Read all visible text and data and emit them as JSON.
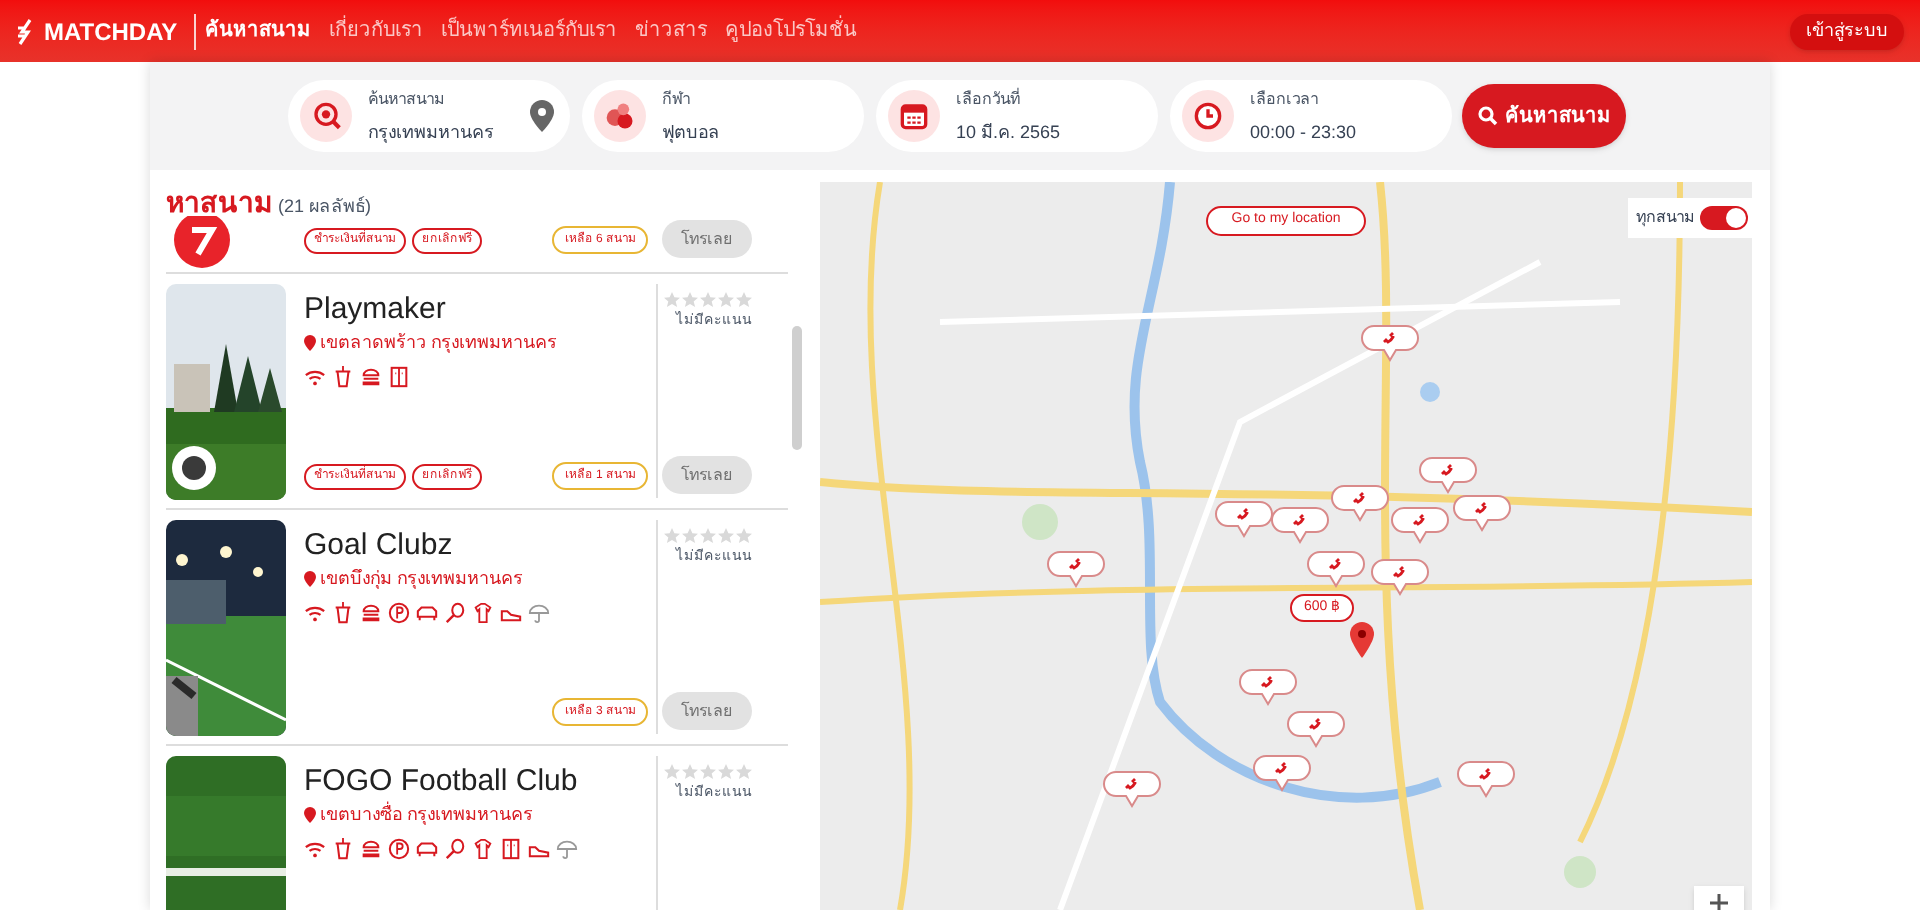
{
  "header": {
    "brand": "MATCHDAY",
    "nav": [
      {
        "label": "ค้นหาสนาม",
        "selected": true
      },
      {
        "label": "เกี่ยวกับเรา",
        "selected": false
      },
      {
        "label": "เป็นพาร์ทเนอร์กับเรา",
        "selected": false
      },
      {
        "label": "ข่าวสาร",
        "selected": false
      },
      {
        "label": "คูปองโปรโมชั่น",
        "selected": false
      }
    ],
    "login": "เข้าสู่ระบบ"
  },
  "search": {
    "fields": [
      {
        "kind": "location",
        "label": "ค้นหาสนาม",
        "value": "กรุงเทพมหานคร"
      },
      {
        "kind": "sport",
        "label": "กีฬา",
        "value": "ฟุตบอล"
      },
      {
        "kind": "date",
        "label": "เลือกวันที่",
        "value": "10 มี.ค. 2565"
      },
      {
        "kind": "time",
        "label": "เลือกเวลา",
        "value": "00:00 - 23:30"
      }
    ],
    "button": "ค้นหาสนาม"
  },
  "results": {
    "title": "หาสนาม",
    "count": "(21 ผลลัพธ์)",
    "venues": [
      {
        "logo": true,
        "tags": [
          "ชำระเงินที่สนาม",
          "ยกเลิกฟรี"
        ],
        "remaining": "เหลือ 6 สนาม",
        "call": "โทรเลย"
      },
      {
        "name": "Playmaker",
        "location": "เขตลาดพร้าว กรุงเทพมหานคร",
        "photo": {
          "kind": "picture"
        },
        "amenities": [
          {
            "kind": "wifi"
          },
          {
            "kind": "cup"
          },
          {
            "kind": "burger"
          },
          {
            "kind": "locker"
          }
        ],
        "stars": 0,
        "rating": "ไม่มีคะแนน",
        "tags": [
          "ชำระเงินที่สนาม",
          "ยกเลิกฟรี"
        ],
        "remaining": "เหลือ 1 สนาม",
        "call": "โทรเลย"
      },
      {
        "name": "Goal Clubz",
        "location": "เขตบึงกุ่ม กรุงเทพมหานคร",
        "photo": {
          "kind": "picture"
        },
        "amenities": [
          {
            "kind": "wifi"
          },
          {
            "kind": "cup"
          },
          {
            "kind": "burger"
          },
          {
            "kind": "parking"
          },
          {
            "kind": "car"
          },
          {
            "kind": "racket"
          },
          {
            "kind": "shirt"
          },
          {
            "kind": "shoe"
          },
          {
            "kind": "umbrella"
          }
        ],
        "stars": 0,
        "rating": "ไม่มีคะแนน",
        "remaining": "เหลือ 3 สนาม",
        "call": "โทรเลย"
      },
      {
        "name": "FOGO Football Club",
        "location": "เขตบางซื่อ กรุงเทพมหานคร",
        "photo": {
          "kind": "picture"
        },
        "amenities": [
          {
            "kind": "wifi"
          },
          {
            "kind": "cup"
          },
          {
            "kind": "burger"
          },
          {
            "kind": "parking"
          },
          {
            "kind": "car"
          },
          {
            "kind": "racket"
          },
          {
            "kind": "shirt"
          },
          {
            "kind": "locker"
          },
          {
            "kind": "shoe"
          },
          {
            "kind": "umbrella"
          }
        ],
        "stars": 0,
        "rating": "ไม่มีคะแนน"
      }
    ]
  },
  "map": {
    "locate_button": "Go to my location",
    "toggle": {
      "label": "ทุกสนาม",
      "on": true
    },
    "markers": [
      {
        "kind": "phone"
      },
      {
        "kind": "phone"
      },
      {
        "kind": "phone"
      },
      {
        "kind": "phone"
      },
      {
        "kind": "phone"
      },
      {
        "kind": "phone"
      },
      {
        "kind": "phone"
      },
      {
        "kind": "phone"
      },
      {
        "kind": "phone"
      },
      {
        "kind": "price",
        "label": "600 ฿"
      },
      {
        "kind": "phone"
      },
      {
        "kind": "phone"
      },
      {
        "kind": "phone"
      },
      {
        "kind": "phone"
      },
      {
        "kind": "phone"
      },
      {
        "kind": "phone"
      }
    ]
  }
}
